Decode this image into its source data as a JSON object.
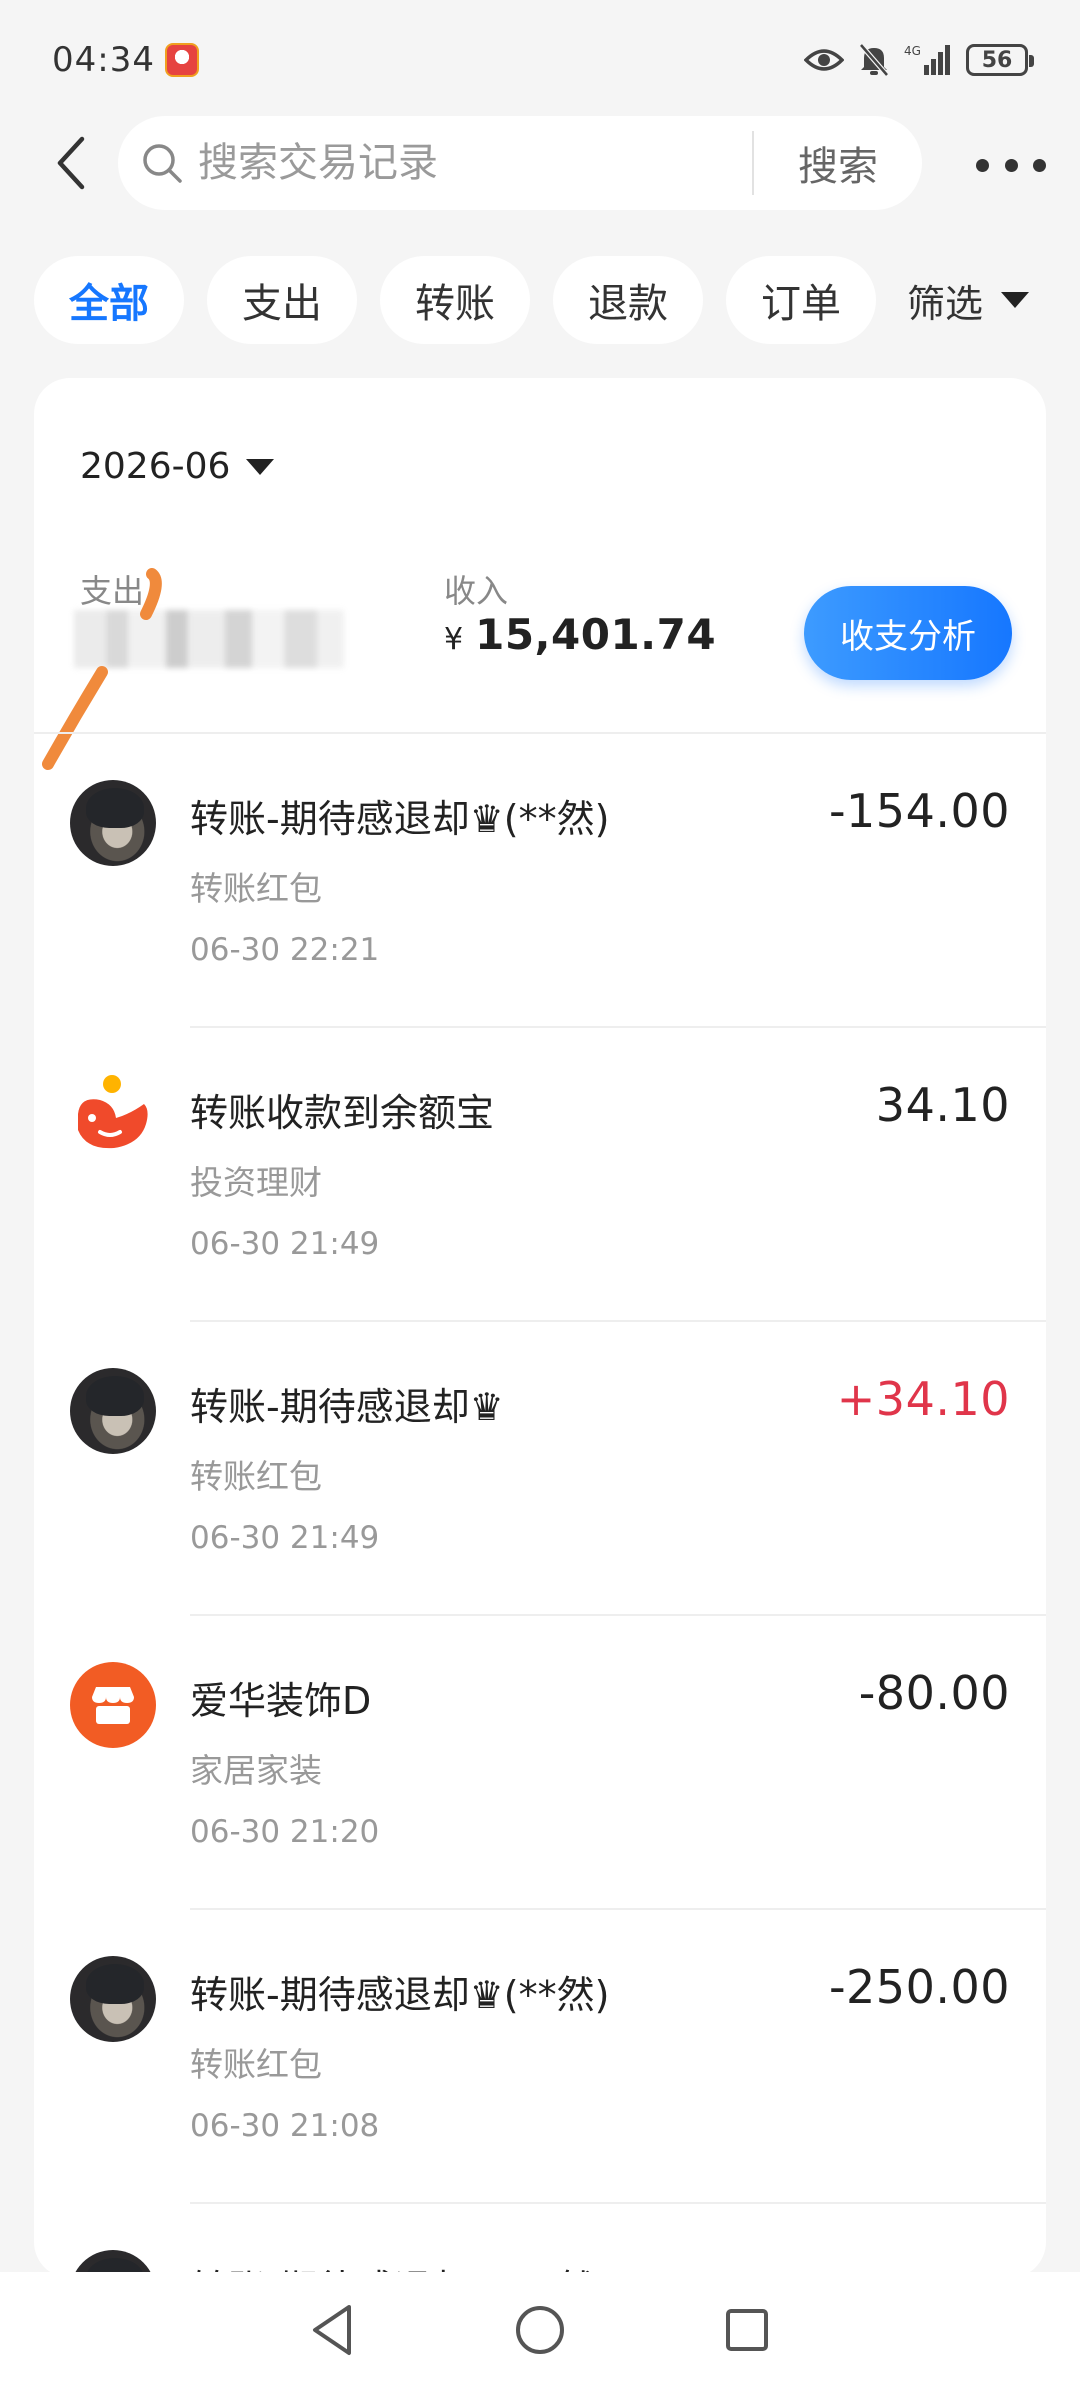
{
  "status_bar": {
    "time": "04:34",
    "network": "4G",
    "battery": "56"
  },
  "header": {
    "search_placeholder": "搜索交易记录",
    "search_button": "搜索"
  },
  "tabs": [
    {
      "label": "全部",
      "active": true
    },
    {
      "label": "支出",
      "active": false
    },
    {
      "label": "转账",
      "active": false
    },
    {
      "label": "退款",
      "active": false
    },
    {
      "label": "订单",
      "active": false
    }
  ],
  "filter_label": "筛选",
  "summary": {
    "month": "2026-06",
    "expense_label": "支出",
    "income_label": "收入",
    "currency": "¥",
    "income_amount": "15,401.74",
    "analysis_button": "收支分析"
  },
  "transactions": [
    {
      "title": "转账-期待感退却♛(**然)",
      "category": "转账红包",
      "time": "06-30 22:21",
      "amount": "-154.00",
      "avatar": "person"
    },
    {
      "title": "转账收款到余额宝",
      "category": "投资理财",
      "time": "06-30 21:49",
      "amount": "34.10",
      "avatar": "yuebao"
    },
    {
      "title": "转账-期待感退却♛",
      "category": "转账红包",
      "time": "06-30 21:49",
      "amount": "+34.10",
      "avatar": "person"
    },
    {
      "title": "爱华装饰D",
      "category": "家居家装",
      "time": "06-30 21:20",
      "amount": "-80.00",
      "avatar": "shop"
    },
    {
      "title": "转账-期待感退却♛(**然)",
      "category": "转账红包",
      "time": "06-30 21:08",
      "amount": "-250.00",
      "avatar": "person"
    }
  ],
  "colors": {
    "accent": "#1677ff",
    "positive_amount": "#e0354a",
    "background": "#f5f5f5"
  }
}
